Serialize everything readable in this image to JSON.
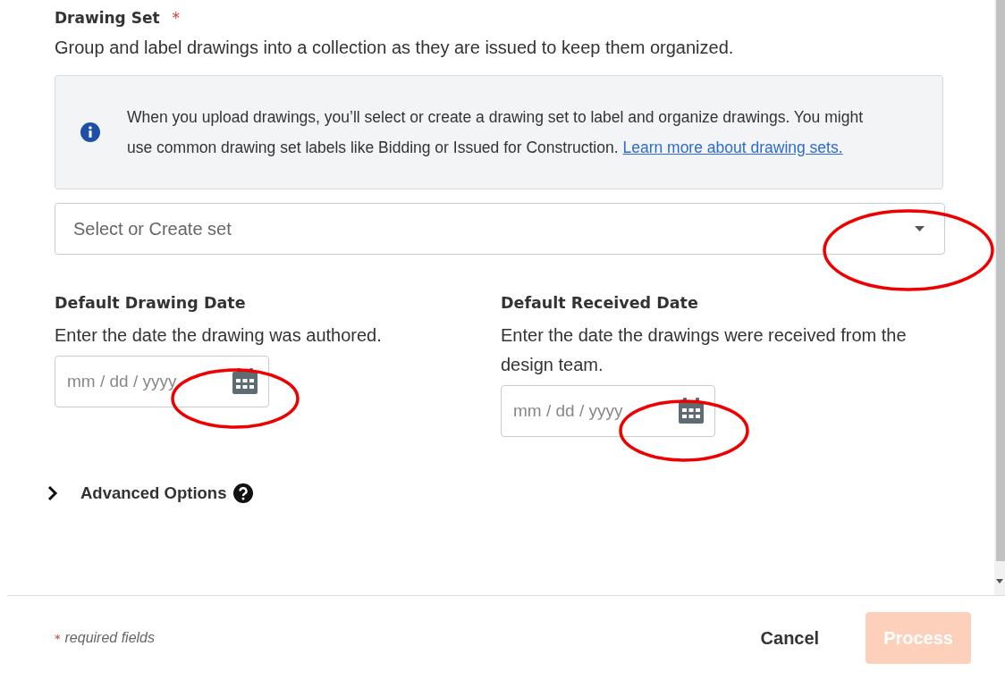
{
  "form": {
    "title": "Drawing Set",
    "title_mark": "*",
    "description": "Group and label drawings into a collection as they are issued to keep them organized.",
    "info": {
      "text": "When you upload drawings, you’ll select or create a drawing set to label and organize drawings. You might use common drawing set labels like Bidding or Issued for Construction.",
      "link": "Learn more about drawing sets."
    },
    "select": {
      "placeholder": "Select or Create set"
    },
    "dates": [
      {
        "label": "Default Drawing Date",
        "description": "Enter the date the drawing was authored.",
        "placeholder": "mm / dd / yyyy"
      },
      {
        "label": "Default Received Date",
        "description": "Enter the date the drawings were received from the design team.",
        "placeholder": "mm / dd / yyyy"
      }
    ],
    "advanced": {
      "label": "Advanced Options",
      "expanded": false
    }
  },
  "footer": {
    "required_mark": "*",
    "required_note": "required fields",
    "buttons": [
      {
        "label": "Cancel",
        "kind": "secondary",
        "disabled": false
      },
      {
        "label": "Process",
        "kind": "primary",
        "disabled": true
      }
    ]
  }
}
